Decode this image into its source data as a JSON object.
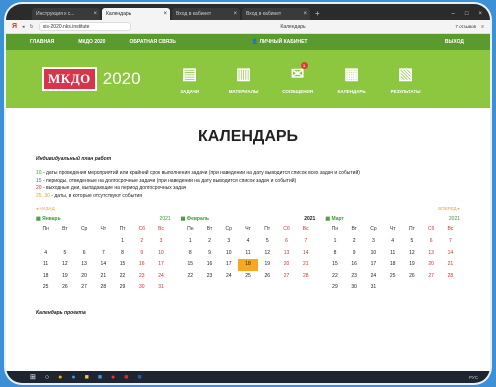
{
  "tabs": [
    {
      "label": "Инструкция к с..."
    },
    {
      "label": "Календарь",
      "active": true
    },
    {
      "label": "Вход в кабинет"
    },
    {
      "label": "Вход в кабинет"
    }
  ],
  "address": {
    "url": "sis-2020.nks.institute",
    "title": "Календарь",
    "reviews": "7 отзывов"
  },
  "topnav": {
    "home": "ГЛАВНАЯ",
    "mkdo": "МКДО 2020",
    "feedback": "ОБРАТНАЯ СВЯЗЬ",
    "cabinet": "ЛИЧНЫЙ КАБИНЕТ",
    "exit": "ВЫХОД"
  },
  "brand": {
    "logo": "МКДО",
    "year": "2020"
  },
  "menu": [
    {
      "label": "ЗАДАЧИ",
      "icon": "tasks-icon",
      "glyph": "▤"
    },
    {
      "label": "МАТЕРИАЛЫ",
      "icon": "materials-icon",
      "glyph": "▥"
    },
    {
      "label": "СООБЩЕНИЯ",
      "icon": "messages-icon",
      "glyph": "✉",
      "badge": "1"
    },
    {
      "label": "КАЛЕНДАРЬ",
      "icon": "calendar-icon",
      "glyph": "▦"
    },
    {
      "label": "РЕЗУЛЬТАТЫ",
      "icon": "results-icon",
      "glyph": "▧"
    }
  ],
  "page": {
    "title": "КАЛЕНДАРЬ",
    "plan_title": "Индивидуальный план работ",
    "project_title": "Календарь проекта"
  },
  "legend": [
    {
      "num": "10",
      "cls": "n10",
      "text": " - даты проведения мероприятий или крайний срок выполнения задачи (при наведении на дату выводится список всех задач и событий)"
    },
    {
      "num": "15",
      "cls": "n15",
      "text": " - периоды, отведенные на долгосрочные задачи (при наведении на дату выводится список задач и событий)"
    },
    {
      "num": "20",
      "cls": "n20",
      "text": " - выходные дни, выпадающие на период долгосрочных задач"
    },
    {
      "num": "25, 30",
      "cls": "n25",
      "text": " - даты, в которые отсутствуют события"
    }
  ],
  "nav": {
    "prev": "◂ НАЗАД",
    "next": "ВПЕРЕД ▸"
  },
  "weekdays": [
    "Пн",
    "Вт",
    "Ср",
    "Чт",
    "Пт",
    "Сб",
    "Вс"
  ],
  "months": [
    {
      "name": "Январь",
      "year": "2021",
      "offset": 4,
      "days": 31,
      "today": null
    },
    {
      "name": "Февраль",
      "year": "2021",
      "offset": 0,
      "days": 28,
      "today": 18
    },
    {
      "name": "Март",
      "year": "2021",
      "offset": 0,
      "days": 31,
      "today": null
    }
  ],
  "taskbar": {
    "clock": "РУС"
  }
}
